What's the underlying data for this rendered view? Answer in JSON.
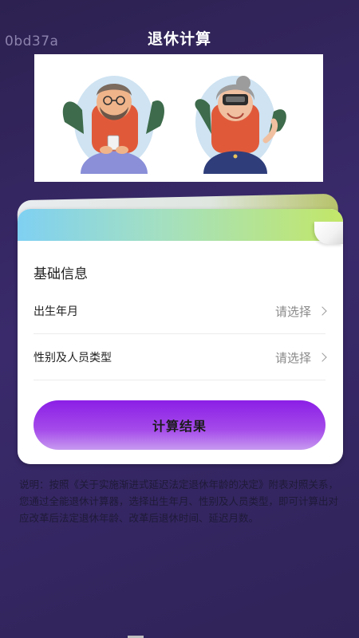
{
  "watermark": "0bd37a",
  "header": {
    "title": "退休计算"
  },
  "banner": {
    "left_figure": "elderly-man-with-phone",
    "right_figure": "elderly-woman-with-vr-headset"
  },
  "form": {
    "section_title": "基础信息",
    "birth": {
      "label": "出生年月",
      "value": "请选择"
    },
    "category": {
      "label": "性别及人员类型",
      "value": "请选择"
    },
    "submit_label": "计算结果"
  },
  "note": "说明：按照《关于实施渐进式延迟法定退休年龄的决定》附表对照关系，您通过全能退休计算器，选择出生年月、性别及人员类型，即可计算出对应改革后法定退休年龄、改革后退休时间、延迟月数。",
  "colors": {
    "button_start": "#8b1fe6",
    "button_end": "#c79af0",
    "accent_gradient": [
      "#7fd0f2",
      "#c3e768"
    ]
  }
}
